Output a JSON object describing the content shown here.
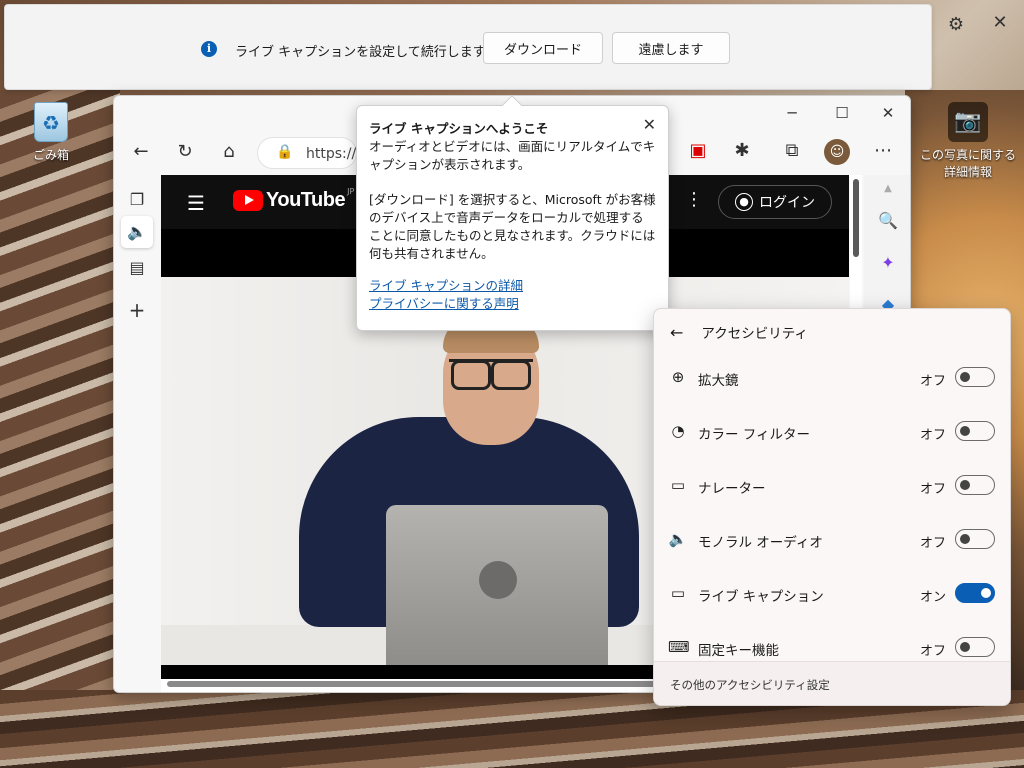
{
  "notification": {
    "message": "ライブ キャプションを設定して続行します。",
    "download_label": "ダウンロード",
    "decline_label": "遠慮します"
  },
  "desktop": {
    "recycle_bin_label": "ごみ箱",
    "photo_info_label": "この写真に関する詳細情報"
  },
  "browser": {
    "url": "https://v",
    "youtube": {
      "logo_text": "YouTube",
      "region": "JP",
      "login_label": "ログイン"
    }
  },
  "popover": {
    "title": "ライブ キャプションへようこそ",
    "para1": "オーディオとビデオには、画面にリアルタイムでキャプションが表示されます。",
    "para2": "[ダウンロード] を選択すると、Microsoft がお客様のデバイス上で音声データをローカルで処理することに同意したものと見なされます。クラウドには何も共有されません。",
    "link1": "ライブ キャプションの詳細",
    "link2": "プライバシーに関する声明"
  },
  "accessibility": {
    "title": "アクセシビリティ",
    "items": [
      {
        "label": "拡大鏡",
        "state": "オフ",
        "on": false,
        "icon": "magnifier-icon"
      },
      {
        "label": "カラー フィルター",
        "state": "オフ",
        "on": false,
        "icon": "color-filter-icon"
      },
      {
        "label": "ナレーター",
        "state": "オフ",
        "on": false,
        "icon": "narrator-icon"
      },
      {
        "label": "モノラル オーディオ",
        "state": "オフ",
        "on": false,
        "icon": "mono-audio-icon"
      },
      {
        "label": "ライブ キャプション",
        "state": "オン",
        "on": true,
        "icon": "live-caption-icon"
      },
      {
        "label": "固定キー機能",
        "state": "オフ",
        "on": false,
        "icon": "sticky-keys-icon"
      }
    ],
    "footer": "その他のアクセシビリティ設定"
  },
  "colors": {
    "accent": "#0a5fb4",
    "youtube_red": "#ff0000"
  }
}
